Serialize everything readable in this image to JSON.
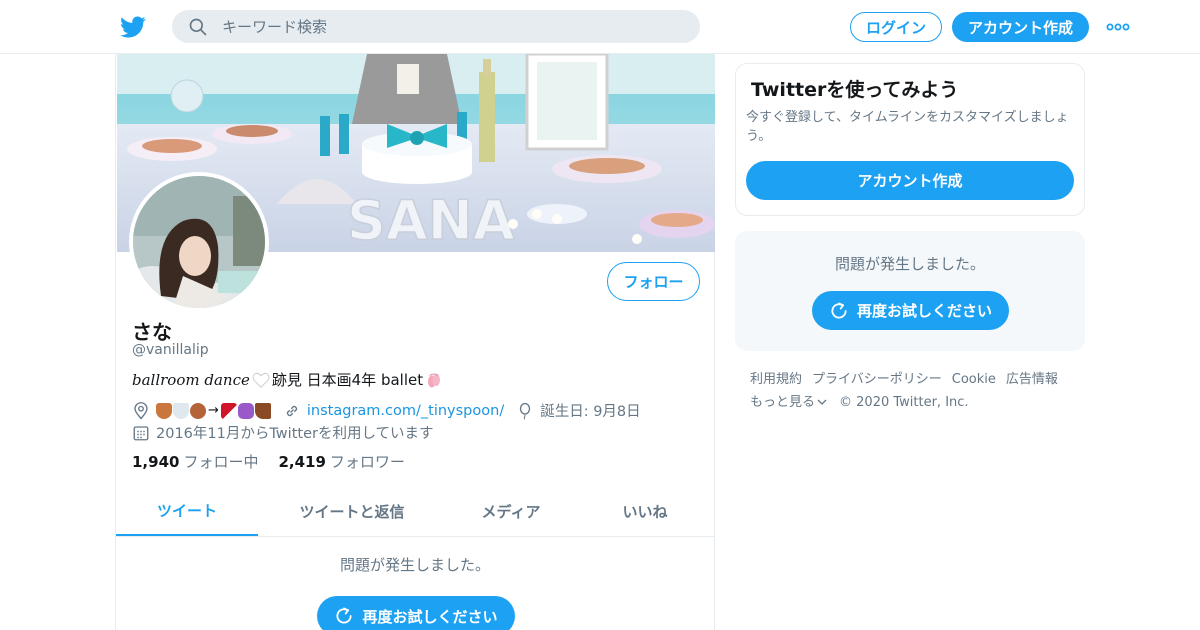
{
  "header": {
    "search_placeholder": "キーワード検索",
    "login_label": "ログイン",
    "signup_label": "アカウント作成"
  },
  "profile": {
    "follow_label": "フォロー",
    "name": "さな",
    "handle": "@vanillalip",
    "bio_italic": "ballroom dance",
    "bio_text": "跡見 日本画4年 ballet",
    "location_emojis": "🧺🛁🧸→👠👛👢",
    "location_arrow": "→",
    "website": "instagram.com/_tinyspoon/",
    "birthday": "誕生日: 9月8日",
    "joined": "2016年11月からTwitterを利用しています",
    "following_count": "1,940",
    "following_label": "フォロー中",
    "followers_count": "2,419",
    "followers_label": "フォロワー",
    "banner_text": "SANA"
  },
  "tabs": [
    {
      "label": "ツイート",
      "active": true
    },
    {
      "label": "ツイートと返信",
      "active": false
    },
    {
      "label": "メディア",
      "active": false
    },
    {
      "label": "いいね",
      "active": false
    }
  ],
  "timeline": {
    "error_text": "問題が発生しました。",
    "retry_label": "再度お試しください"
  },
  "sidebar": {
    "signup_card": {
      "title": "Twitterを使ってみよう",
      "description": "今すぐ登録して、タイムラインをカスタマイズしましょう。",
      "button_label": "アカウント作成"
    },
    "error_card": {
      "text": "問題が発生しました。",
      "retry_label": "再度お試しください"
    },
    "footer": {
      "links": [
        "利用規約",
        "プライバシーポリシー",
        "Cookie",
        "広告情報"
      ],
      "more_label": "もっと見る",
      "copyright": "© 2020 Twitter, Inc."
    }
  },
  "colors": {
    "accent": "#1da1f2",
    "link": "#1b95e0",
    "muted": "#657786",
    "text": "#14171a",
    "border": "#e6ecf0"
  }
}
